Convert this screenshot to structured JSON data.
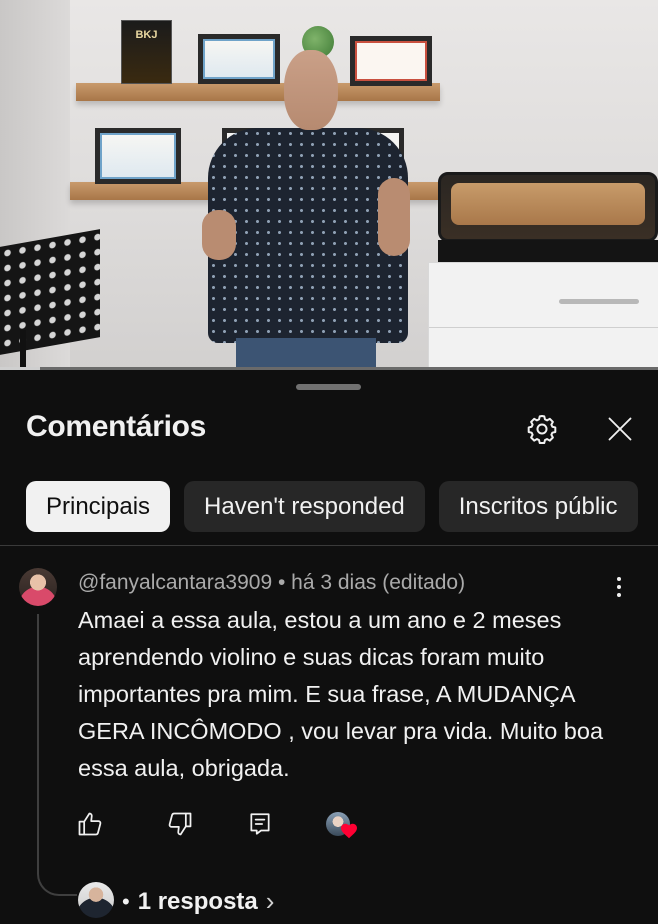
{
  "video": {
    "book_label": "BKJ",
    "progress_fraction": 0.0
  },
  "comments_sheet": {
    "title": "Comentários",
    "settings_icon": "gear-icon",
    "close_icon": "close-icon",
    "filters": [
      {
        "label": "Principais",
        "active": true
      },
      {
        "label": "Haven't responded",
        "active": false
      },
      {
        "label": "Inscritos públic",
        "active": false
      }
    ]
  },
  "comment": {
    "author": "@fanyalcantara3909",
    "separator": " • ",
    "time": "há 3 dias (editado)",
    "text": "Amaei a essa aula, estou a um ano e 2 meses aprendendo violino e suas dicas  foram muito importantes  pra mim. E sua frase,   A MUDANÇA GERA INCÔMODO , vou levar pra vida. Muito boa essa aula, obrigada.",
    "actions": {
      "like_icon": "thumb-up-icon",
      "dislike_icon": "thumb-down-icon",
      "reply_icon": "comment-reply-icon",
      "heart_icon": "heart-icon",
      "heart_color": "#ff0033"
    },
    "replies": {
      "dot": "•",
      "label": "1 resposta",
      "chevron": "›"
    }
  }
}
